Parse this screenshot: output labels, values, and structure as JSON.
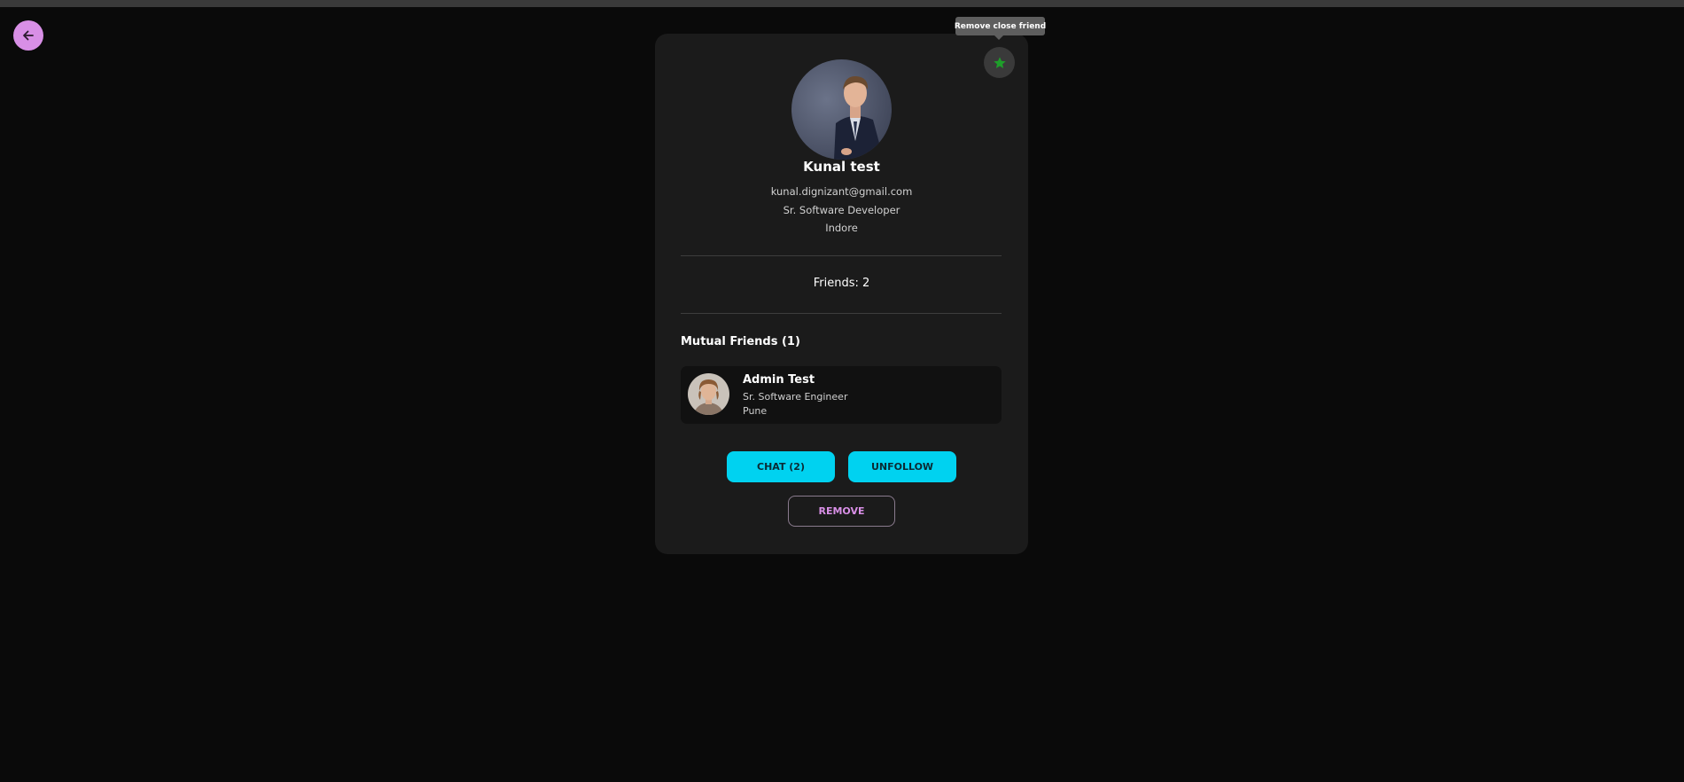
{
  "tooltip": {
    "text": "Remove close friend"
  },
  "icons": {
    "back": "arrow-left-icon",
    "close_friend": "star-icon"
  },
  "colors": {
    "background": "#0a0a0a",
    "card": "#1b1b1b",
    "accent_purple": "#d88fe6",
    "accent_cyan": "#00d2f0",
    "star_green": "#1e9e2a"
  },
  "profile": {
    "name": "Kunal test",
    "email": "kunal.dignizant@gmail.com",
    "title": "Sr. Software Developer",
    "location": "Indore"
  },
  "stats": {
    "friends_label": "Friends: 2"
  },
  "mutual": {
    "title": "Mutual Friends (1)",
    "friends": [
      {
        "name": "Admin Test",
        "title": "Sr. Software Engineer",
        "location": "Pune"
      }
    ]
  },
  "actions": {
    "chat_label": "CHAT (2)",
    "unfollow_label": "UNFOLLOW",
    "remove_label": "REMOVE"
  }
}
